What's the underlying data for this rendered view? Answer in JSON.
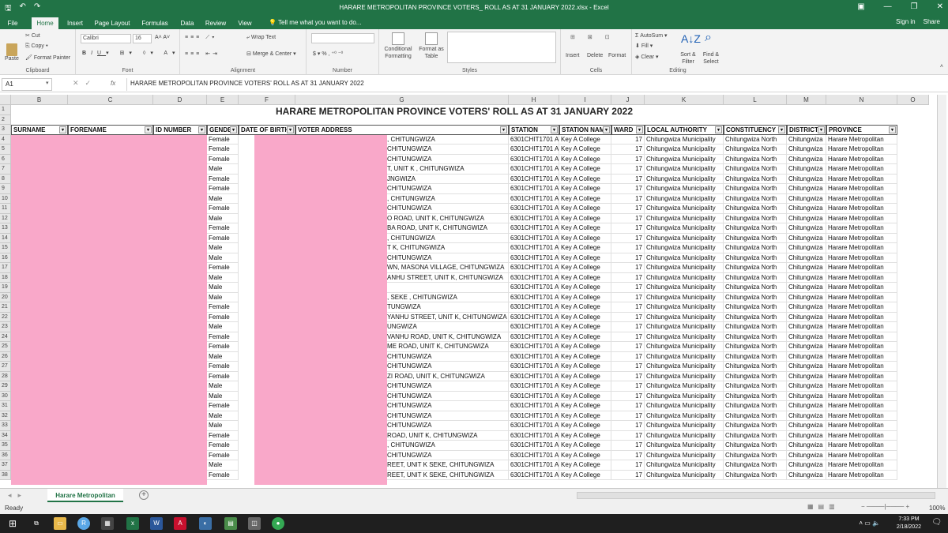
{
  "window": {
    "title": "HARARE METROPOLITAN PROVINCE VOTERS_ ROLL AS AT 31 JANUARY 2022.xlsx - Excel"
  },
  "ribbon_tabs": [
    "File",
    "Home",
    "Insert",
    "Page Layout",
    "Formulas",
    "Data",
    "Review",
    "View"
  ],
  "tell_me": "Tell me what you want to do...",
  "account": {
    "sign_in": "Sign in",
    "share": "Share"
  },
  "ribbon": {
    "clipboard": {
      "paste": "Paste",
      "cut": "Cut",
      "copy": "Copy",
      "format_painter": "Format Painter",
      "label": "Clipboard"
    },
    "font": {
      "name": "Calibri",
      "size": "16",
      "label": "Font"
    },
    "alignment": {
      "wrap": "Wrap Text",
      "merge": "Merge & Center",
      "label": "Alignment"
    },
    "number": {
      "label": "Number",
      "currency": "$",
      "percent": "%"
    },
    "styles": {
      "conditional": "Conditional Formatting",
      "format_as_table": "Format as Table",
      "label": "Styles"
    },
    "cells": {
      "insert": "Insert",
      "delete": "Delete",
      "format": "Format",
      "label": "Cells"
    },
    "editing": {
      "autosum": "AutoSum",
      "fill": "Fill",
      "clear": "Clear",
      "sort": "Sort & Filter",
      "find": "Find & Select",
      "label": "Editing"
    }
  },
  "formula_bar": {
    "name_box": "A1",
    "fx": "fx",
    "content": "HARARE METROPOLITAN PROVINCE VOTERS' ROLL AS AT 31 JANUARY 2022"
  },
  "columns": [
    "B",
    "C",
    "D",
    "E",
    "F",
    "G",
    "H",
    "I",
    "J",
    "K",
    "L",
    "M",
    "N",
    "O"
  ],
  "sheet_title": "HARARE METROPOLITAN PROVINCE VOTERS' ROLL AS AT 31 JANUARY 2022",
  "headers": [
    "SURNAME",
    "FORENAME",
    "ID NUMBER",
    "GENDE",
    "DATE OF BIRTH",
    "VOTER ADDRESS",
    "STATION",
    "STATION NAM",
    "WARD",
    "LOCAL AUTHORITY",
    "CONSTITUENCY",
    "DISTRICT",
    "PROVINCE"
  ],
  "row_numbers": [
    "1",
    "2",
    "3",
    "4",
    "5",
    "6",
    "7",
    "8",
    "9",
    "10",
    "11",
    "12",
    "13",
    "14",
    "15",
    "16",
    "17",
    "18",
    "19",
    "20",
    "21",
    "22",
    "23",
    "24",
    "25",
    "26",
    "27",
    "28",
    "29",
    "30",
    "31",
    "32",
    "33",
    "34",
    "35",
    "36",
    "37",
    "38"
  ],
  "rows": [
    {
      "gender": "Female",
      "address": ", CHITUNGWIZA"
    },
    {
      "gender": "Female",
      "address": "CHITUNGWIZA"
    },
    {
      "gender": "Female",
      "address": "CHITUNGWIZA"
    },
    {
      "gender": "Male",
      "address": "T,  UNIT K , CHITUNGWIZA"
    },
    {
      "gender": "Female",
      "address": "JNGWIZA"
    },
    {
      "gender": "Female",
      "address": "CHITUNGWIZA"
    },
    {
      "gender": "Male",
      "address": ", CHITUNGWIZA"
    },
    {
      "gender": "Female",
      "address": "CHITUNGWIZA"
    },
    {
      "gender": "Male",
      "address": "O ROAD, UNIT K, CHITUNGWIZA"
    },
    {
      "gender": "Female",
      "address": "BA ROAD, UNIT K, CHITUNGWIZA"
    },
    {
      "gender": "Female",
      "address": ", CHITUNGWIZA"
    },
    {
      "gender": "Male",
      "address": "T K, CHITUNGWIZA"
    },
    {
      "gender": "Male",
      "address": "CHITUNGWIZA"
    },
    {
      "gender": "Female",
      "address": "WN, MASONA VILLAGE, CHITUNGWIZA"
    },
    {
      "gender": "Male",
      "address": "ANHU STREET, UNIT K, CHITUNGWIZA"
    },
    {
      "gender": "Male",
      "address": ""
    },
    {
      "gender": "Male",
      "address": ", SEKE , CHITUNGWIZA"
    },
    {
      "gender": "Female",
      "address": "TUNGWIZA"
    },
    {
      "gender": "Female",
      "address": "YANHU STREET, UNIT K, CHITUNGWIZA"
    },
    {
      "gender": "Male",
      "address": "UNGWIZA"
    },
    {
      "gender": "Female",
      "address": "VANHU ROAD, UNIT K, CHITUNGWIZA"
    },
    {
      "gender": "Female",
      "address": "ME ROAD, UNIT K, CHITUNGWIZA"
    },
    {
      "gender": "Male",
      "address": "CHITUNGWIZA"
    },
    {
      "gender": "Female",
      "address": "CHITUNGWIZA"
    },
    {
      "gender": "Female",
      "address": "ZI ROAD, UNIT K, CHITUNGWIZA"
    },
    {
      "gender": "Male",
      "address": "CHITUNGWIZA"
    },
    {
      "gender": "Male",
      "address": "CHITUNGWIZA"
    },
    {
      "gender": "Female",
      "address": "CHITUNGWIZA"
    },
    {
      "gender": "Male",
      "address": "CHITUNGWIZA"
    },
    {
      "gender": "Male",
      "address": "CHITUNGWIZA"
    },
    {
      "gender": "Female",
      "address": "ROAD,  UNIT K, CHITUNGWIZA"
    },
    {
      "gender": "Female",
      "address": ", CHITUNGWIZA"
    },
    {
      "gender": "Female",
      "address": "CHITUNGWIZA"
    },
    {
      "gender": "Male",
      "address": "REET, UNIT K SEKE, CHITUNGWIZA"
    },
    {
      "gender": "Female",
      "address": "REET, UNIT K SEKE, CHITUNGWIZA"
    }
  ],
  "common": {
    "station": "6301CHIT1701 A",
    "station_name": "Key A College",
    "ward": "17",
    "local_authority": "Chitungwiza Municipality",
    "constituency": "Chitungwiza North",
    "district": "Chitungwiza",
    "province": "Harare Metropolitan"
  },
  "sheet_tab": "Harare Metropolitan",
  "status": {
    "ready": "Ready",
    "zoom": "100%"
  },
  "clock": {
    "time": "7:33 PM",
    "date": "2/18/2022"
  },
  "colors": {
    "excel_green": "#217346",
    "redaction": "#f9a8c9"
  }
}
